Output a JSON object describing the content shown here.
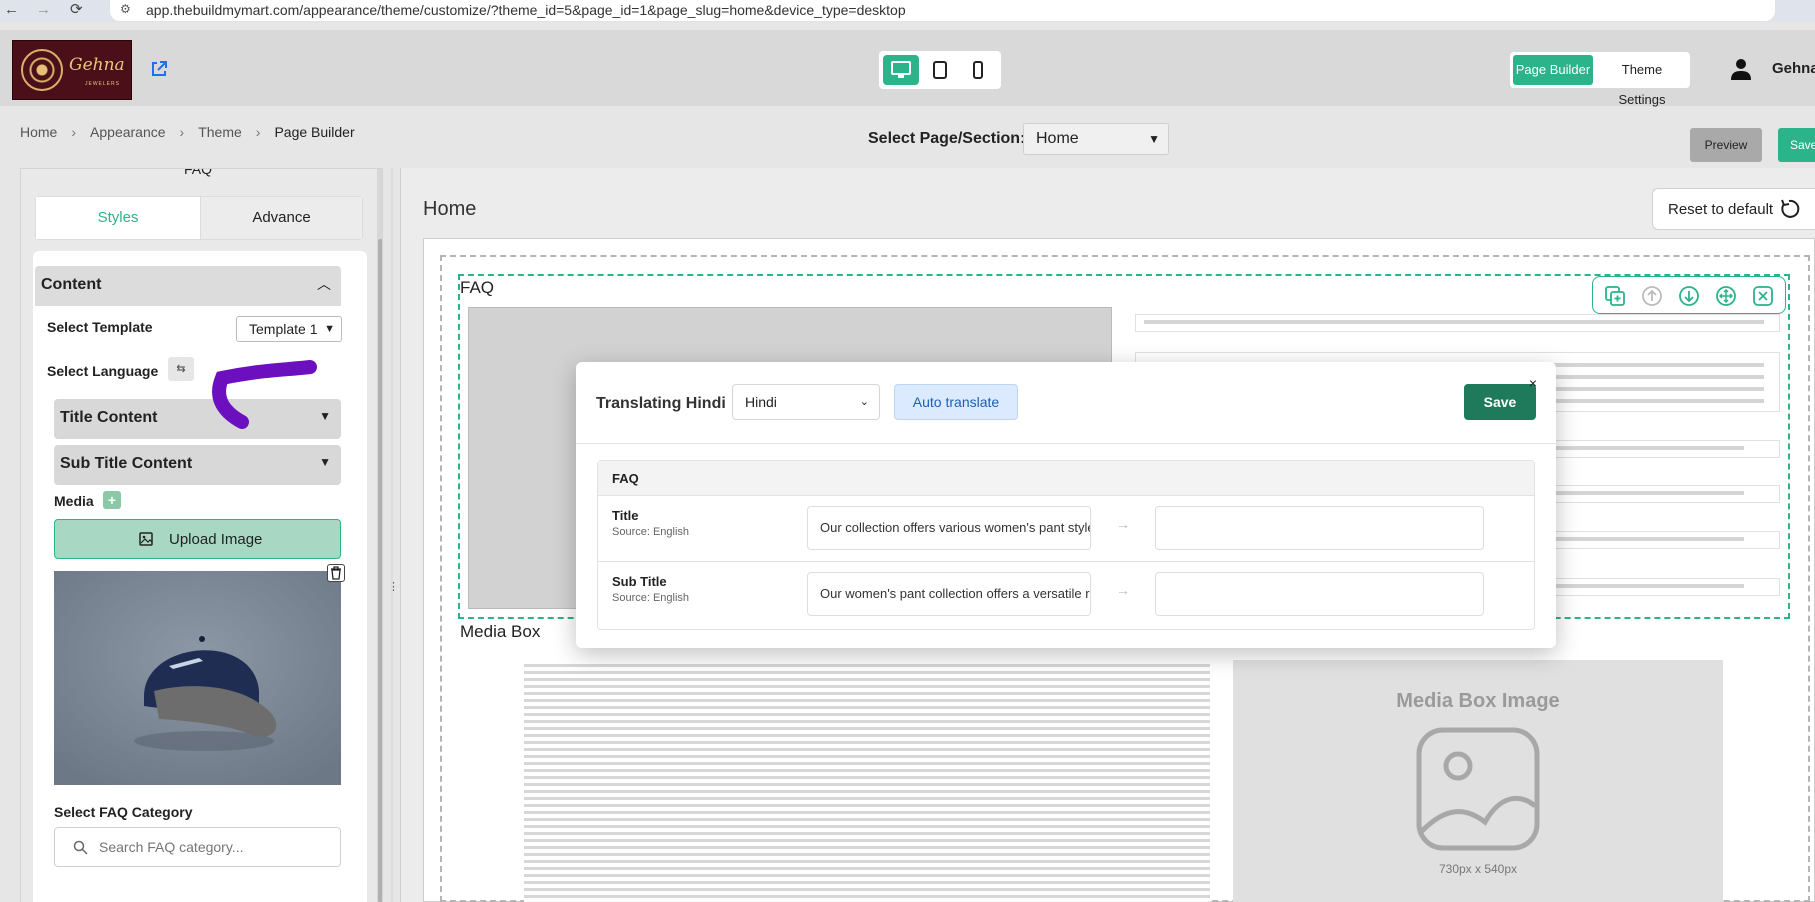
{
  "browser": {
    "url": "app.thebuildmymart.com/appearance/theme/customize/?theme_id=5&page_id=1&page_slug=home&device_type=desktop"
  },
  "topbar": {
    "logo_text": "Gehna",
    "logo_subtext": "JEWELERS",
    "devices": [
      "desktop-icon",
      "tablet-icon",
      "mobile-icon"
    ],
    "active_device": "desktop",
    "tabs": {
      "page_builder": "Page Builder",
      "theme_settings": "Theme Settings"
    },
    "user_name": "Gehna"
  },
  "breadcrumb": [
    "Home",
    "Appearance",
    "Theme",
    "Page Builder"
  ],
  "page_select": {
    "label": "Select Page/Section:",
    "value": "Home"
  },
  "actions": {
    "preview": "Preview",
    "save": "Save"
  },
  "left_panel": {
    "section_title": "FAQ",
    "tabs": {
      "styles": "Styles",
      "advance": "Advance"
    },
    "content_header": "Content",
    "select_template_label": "Select Template",
    "template_value": "Template 1",
    "select_language_label": "Select Language",
    "title_content": "Title Content",
    "sub_title_content": "Sub Title Content",
    "media_label": "Media",
    "upload_image": "Upload Image",
    "faq_category_label": "Select FAQ Category",
    "faq_category_placeholder": "Search FAQ category..."
  },
  "main": {
    "page_title": "Home",
    "reset_label": "Reset to default",
    "faq_section_label": "FAQ",
    "media_box_label": "Media Box",
    "media_box_image_title": "Media Box Image",
    "media_box_image_size": "730px x 540px",
    "toolbar_icons": [
      "duplicate-icon",
      "move-up-icon",
      "move-down-icon",
      "drag-icon",
      "remove-icon"
    ]
  },
  "modal": {
    "title": "Translating Hindi",
    "language": "Hindi",
    "auto_translate": "Auto translate",
    "save": "Save",
    "close": "×",
    "group_header": "FAQ",
    "rows": [
      {
        "name": "Title",
        "source": "Source: English",
        "value": "Our collection offers various women's pant styles",
        "translation": ""
      },
      {
        "name": "Sub Title",
        "source": "Source: English",
        "value": "Our women's pant collection offers a versatile rar",
        "translation": ""
      }
    ]
  },
  "colors": {
    "accent": "#2bb38a",
    "modal_save": "#1f7a5c",
    "annotation": "#6b0fbf"
  }
}
